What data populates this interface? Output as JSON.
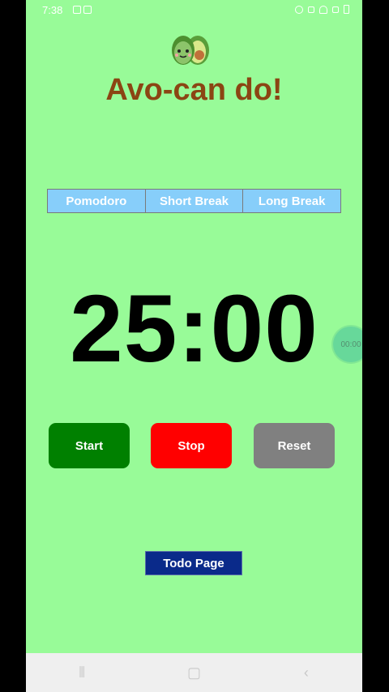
{
  "status_bar": {
    "time": "7:38",
    "left_icons": [
      "video-icon",
      "image-icon"
    ],
    "right_icons": [
      "alarm-icon",
      "mute-icon",
      "wifi-icon",
      "signal-icon",
      "battery-icon"
    ]
  },
  "app": {
    "title": "Avo-can do!",
    "logo_icon": "avocado-icon"
  },
  "tabs": [
    {
      "label": "Pomodoro"
    },
    {
      "label": "Short Break"
    },
    {
      "label": "Long Break"
    }
  ],
  "timer": {
    "display": "25:00"
  },
  "floating_bubble": {
    "text": "00:00"
  },
  "controls": {
    "start_label": "Start",
    "stop_label": "Stop",
    "reset_label": "Reset"
  },
  "todo": {
    "label": "Todo Page"
  },
  "nav_bar": {
    "recent": "⫴",
    "home": "▢",
    "back": "‹"
  },
  "colors": {
    "background": "#98fb98",
    "title": "#8b4513",
    "tab": "#87cefa",
    "start": "#008000",
    "stop": "#ff0000",
    "reset": "#808080",
    "todo": "#0a2a8a"
  }
}
